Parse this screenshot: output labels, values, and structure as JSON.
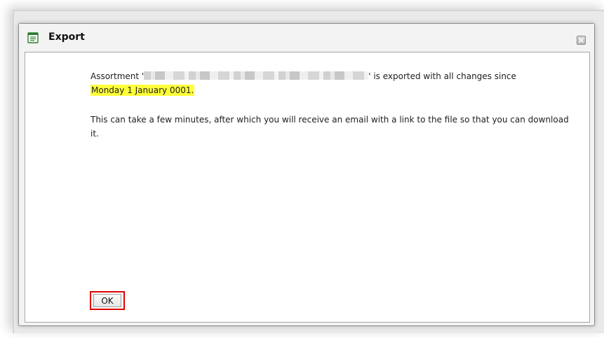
{
  "dialog": {
    "title": "Export",
    "title_icon": "document-list-icon",
    "close_icon": "close-icon"
  },
  "message": {
    "prefix": "Assortment '",
    "redacted_name": "",
    "suffix": "' is exported with all changes since",
    "date_highlight": "Monday 1 January 0001.",
    "highlight_color": "#ffff3a",
    "paragraph2": "This can take a few minutes, after which you will receive an email with a link to the file so that you can download it."
  },
  "buttons": {
    "ok_label": "OK",
    "ok_highlight_color": "#e00000"
  }
}
